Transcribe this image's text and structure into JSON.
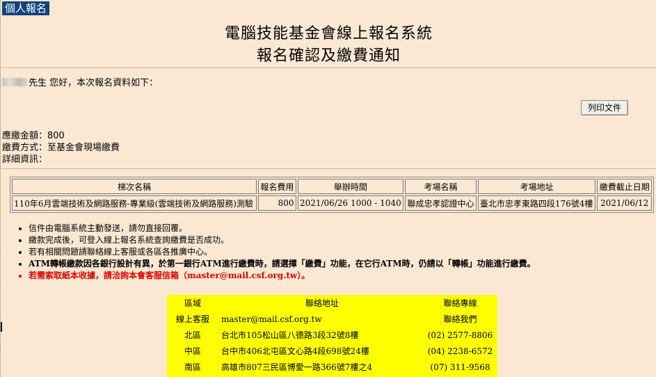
{
  "tab_label": "個人報名",
  "header": {
    "title_line1": "電腦技能基金會線上報名系統",
    "title_line2": "報名確認及繳費通知"
  },
  "greeting_suffix": "先生 您好，本次報名資料如下：",
  "print_button": "列印文件",
  "payment": {
    "amount_label": "應繳金額：",
    "amount_value": "800",
    "method_label": "繳費方式：",
    "method_value": "至基金會現場繳費",
    "detail_label": "詳細資訊："
  },
  "schedule_table": {
    "headers": [
      "梯次名稱",
      "報名費用",
      "舉辦時間",
      "考場名稱",
      "考場地址",
      "繳費截止日期"
    ],
    "rows": [
      [
        "110年6月雲端技術及網路服務-專業級(雲端技術及網路服務)測驗",
        "800",
        "2021/06/26 1000 - 1040",
        "聯成忠孝認證中心",
        "臺北市忠孝東路四段176號4樓",
        "2021/06/12"
      ]
    ]
  },
  "notes": [
    "信件由電腦系統主動發送，請勿直接回覆。",
    "繳款完成後，可登入線上報名系統查詢繳費是否成功。",
    "若有相關問題請聯絡線上客服或各區各推廣中心。",
    "ATM轉帳繳款因各銀行設計有異，於第一銀行ATM進行繳費時，請選擇「繳費」功能，在它行ATM時，仍請以「轉帳」功能進行繳費。",
    "若需索取紙本收據，請洽詢本會客服信箱（master@mail.csf.org.tw）。"
  ],
  "contact_table": {
    "headers": [
      "區域",
      "聯絡地址",
      "聯絡專線"
    ],
    "rows": [
      [
        "線上客服",
        "master@mail.csf.org.tw",
        "聯絡我們"
      ],
      [
        "北區",
        "台北市105松山區八德路3段32號8樓",
        "(02) 2577-8806"
      ],
      [
        "中區",
        "台中市406北屯區文心路4段698號24樓",
        "(04) 2238-6572"
      ],
      [
        "南區",
        "高雄市807三民區博愛一路366號7樓之4",
        "(07) 311-9568"
      ]
    ]
  },
  "colors": {
    "background": "#fbe8d3",
    "tab_bg": "#12447a",
    "highlight": "#ffff00",
    "alert": "#e10000"
  }
}
